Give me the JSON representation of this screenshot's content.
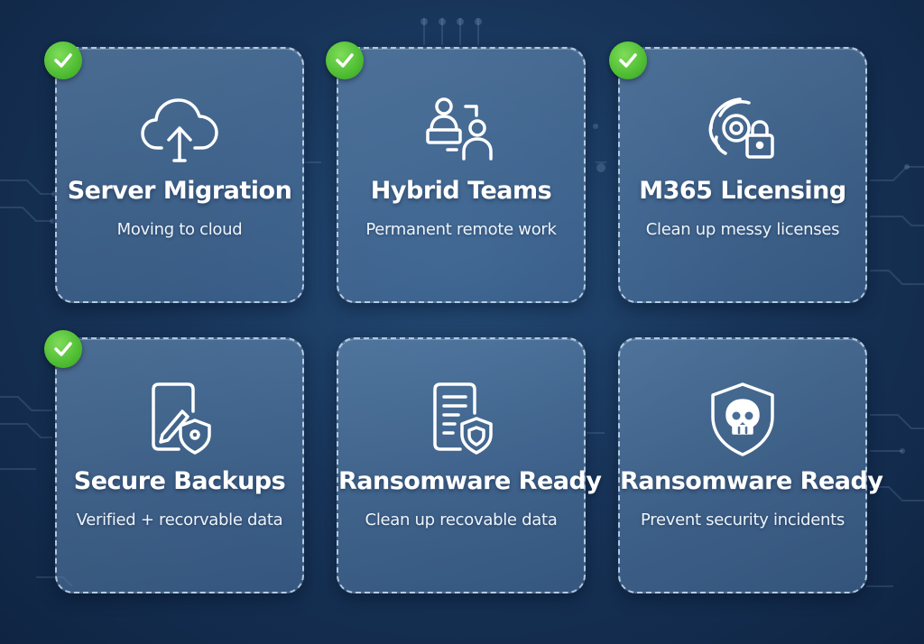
{
  "cards": [
    {
      "title": "Server Migration",
      "subtitle": "Moving to cloud",
      "icon": "cloud-upload-icon",
      "checked": true
    },
    {
      "title": "Hybrid Teams",
      "subtitle": "Permanent remote work",
      "icon": "remote-team-icon",
      "checked": true
    },
    {
      "title": "M365 Licensing",
      "subtitle": "Clean up messy licenses",
      "icon": "license-lock-icon",
      "checked": true
    },
    {
      "title": "Secure Backups",
      "subtitle": "Verified + recorvable data",
      "icon": "backup-shield-icon",
      "checked": true
    },
    {
      "title": "Ransomware Ready",
      "subtitle": "Clean up recovable data",
      "icon": "document-shield-icon",
      "checked": false
    },
    {
      "title": "Ransomware Ready",
      "subtitle": "Prevent security incidents",
      "icon": "skull-shield-icon",
      "checked": false
    }
  ],
  "colors": {
    "background": "#18355a",
    "check": "#4fbd33",
    "text": "#ffffff"
  }
}
